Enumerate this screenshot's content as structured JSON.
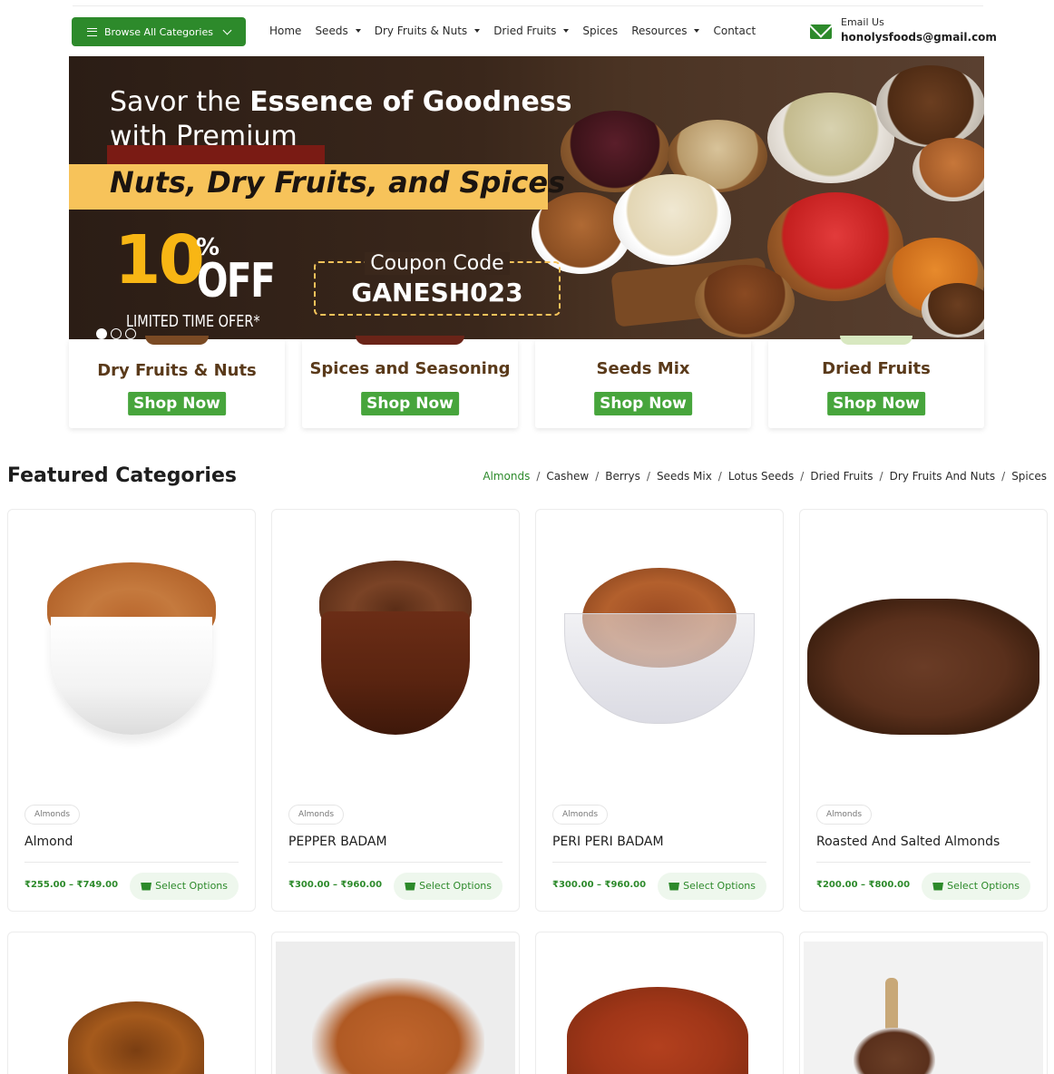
{
  "header": {
    "browse_label": "Browse All Categories",
    "nav": [
      {
        "label": "Home",
        "dropdown": false
      },
      {
        "label": "Seeds",
        "dropdown": true
      },
      {
        "label": "Dry Fruits & Nuts",
        "dropdown": true
      },
      {
        "label": "Dried Fruits",
        "dropdown": true
      },
      {
        "label": "Spices",
        "dropdown": false
      },
      {
        "label": "Resources",
        "dropdown": true
      },
      {
        "label": "Contact",
        "dropdown": false
      }
    ],
    "email_label": "Email Us",
    "email_value": "honolysfoods@gmail.com",
    "accent_color": "#2d8a2b"
  },
  "hero": {
    "line1_prefix": "Savor the ",
    "line1_bold": "Essence of Goodness",
    "line2": "with Premium",
    "band_text": "Nuts, Dry Fruits, and Spices",
    "discount_number": "10",
    "discount_percent": "%",
    "discount_off": "OFF",
    "limited_text": "LIMITED TIME OFER*",
    "coupon_label": "Coupon Code",
    "coupon_code": "GANESH023",
    "slides": 3,
    "active_slide": 1
  },
  "categories": [
    {
      "name": "Dry Fruits & Nuts",
      "button": "Shop Now"
    },
    {
      "name": "Spices and Seasoning",
      "button": "Shop Now"
    },
    {
      "name": "Seeds Mix",
      "button": "Shop Now"
    },
    {
      "name": "Dried Fruits",
      "button": "Shop Now"
    }
  ],
  "featured": {
    "title": "Featured Categories",
    "tabs": [
      "Almonds",
      "Cashew",
      "Berrys",
      "Seeds Mix",
      "Lotus Seeds",
      "Dried Fruits",
      "Dry Fruits And Nuts",
      "Spices"
    ],
    "active_tab": "Almonds",
    "products": [
      {
        "category": "Almonds",
        "name": "Almond",
        "price": "₹255.00 – ₹749.00",
        "button": "Select Options"
      },
      {
        "category": "Almonds",
        "name": "PEPPER BADAM",
        "price": "₹300.00 – ₹960.00",
        "button": "Select Options"
      },
      {
        "category": "Almonds",
        "name": "PERI PERI BADAM",
        "price": "₹300.00 – ₹960.00",
        "button": "Select Options"
      },
      {
        "category": "Almonds",
        "name": "Roasted And Salted Almonds",
        "price": "₹200.00 – ₹800.00",
        "button": "Select Options"
      }
    ]
  }
}
